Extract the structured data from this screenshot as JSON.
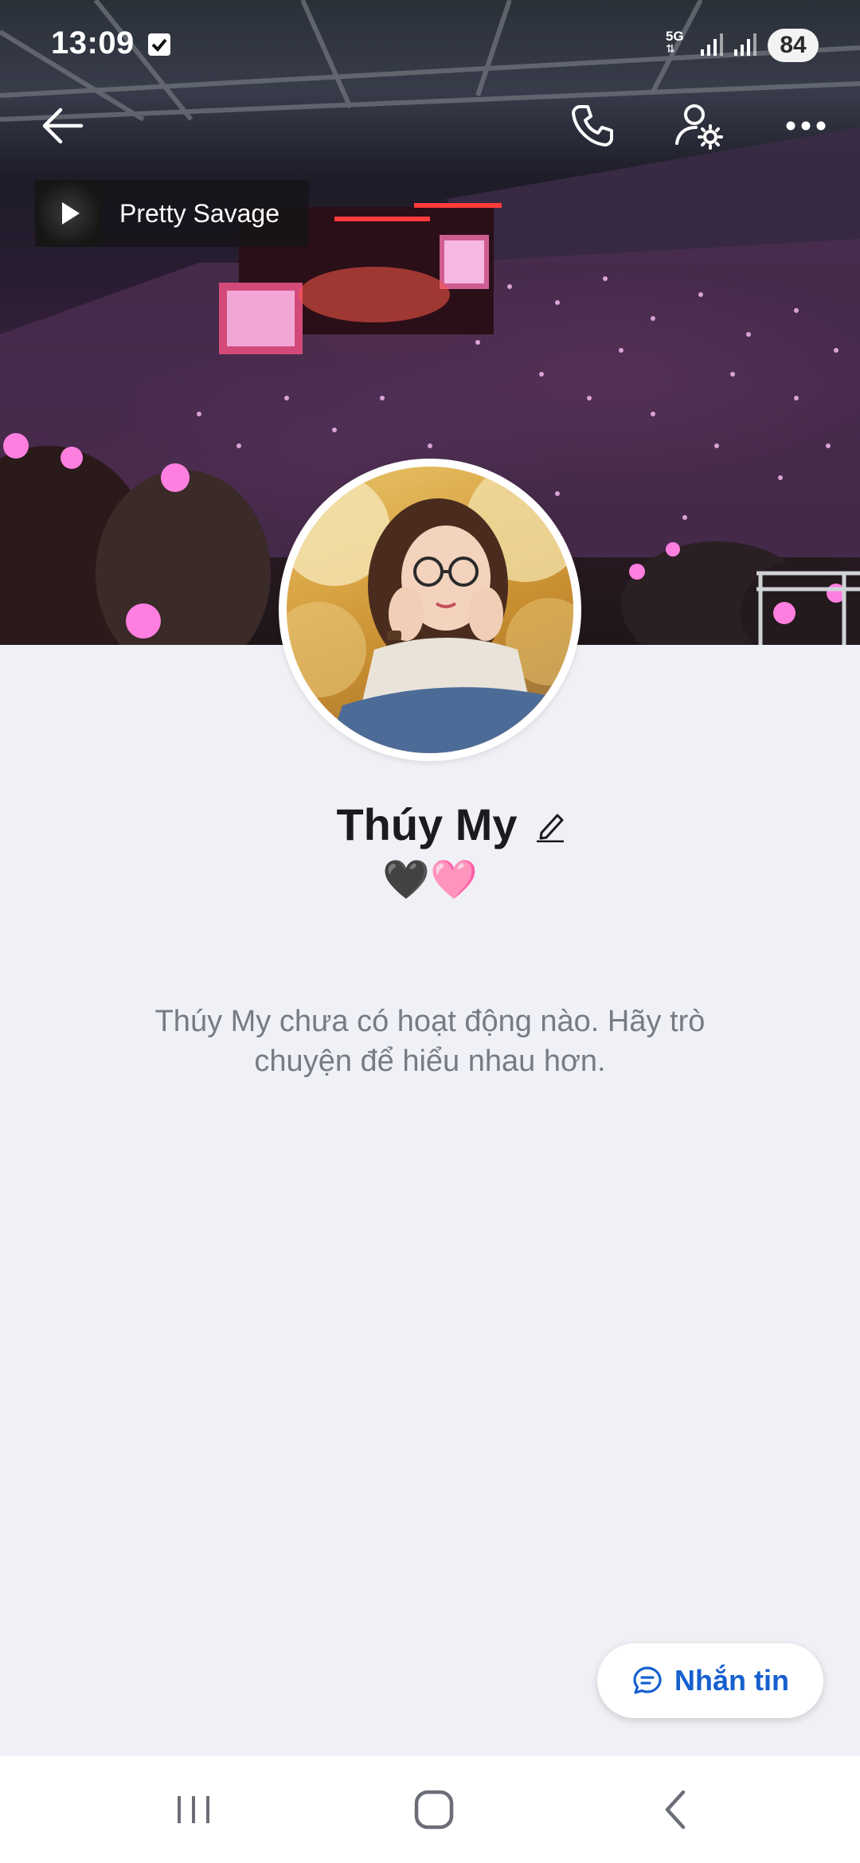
{
  "status_bar": {
    "time": "13:09",
    "network": "5G",
    "battery": "84"
  },
  "header": {
    "back_icon": "arrow-left-icon",
    "call_icon": "phone-icon",
    "settings_icon": "user-settings-icon",
    "more_icon": "more-horizontal-icon"
  },
  "music": {
    "title": "Pretty Savage",
    "icon": "play-icon"
  },
  "profile": {
    "name": "Thúy My",
    "bio": "🖤🩷",
    "edit_icon": "pencil-icon"
  },
  "empty_state": {
    "message": "Thúy My chưa có hoạt động nào. Hãy trò chuyện để hiểu nhau hơn."
  },
  "message_button": {
    "label": "Nhắn tin",
    "icon": "chat-bubble-icon"
  },
  "colors": {
    "background": "#f0f1f6",
    "accent": "#1660cf",
    "text_primary": "#1b1b1f",
    "text_muted": "#787b84"
  }
}
